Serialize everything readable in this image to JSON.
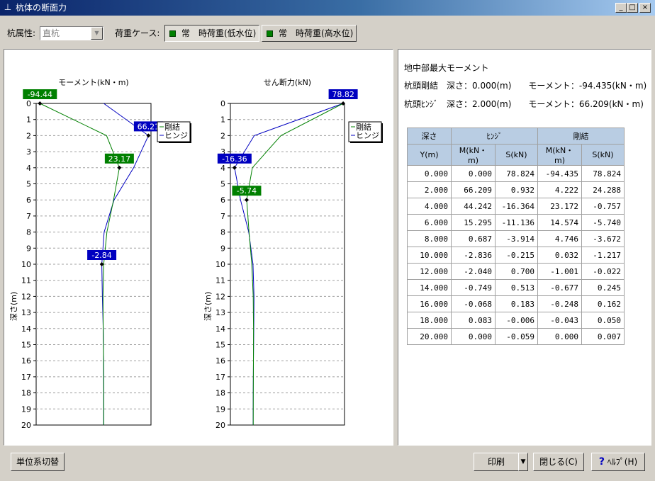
{
  "window": {
    "title": "杭体の断面力",
    "app_icon": "pile-icon",
    "min": "_",
    "max": "□",
    "close": "×"
  },
  "toolbar": {
    "pile_attr_label": "杭属性:",
    "pile_attr_value": "直杭",
    "load_case_label": "荷重ケース:",
    "case_low": "常　時荷重(低水位)",
    "case_high": "常　時荷重(高水位)"
  },
  "info": {
    "title": "地中部最大モーメント",
    "line1": "杭頭剛結　深さ：0.000(m)　　モーメント：-94.435(kN・m)",
    "line2": "杭頭ﾋﾝｼﾞ　深さ：2.000(m)　　モーメント：66.209(kN・m)"
  },
  "table": {
    "h_depth": "深さ",
    "h_hinge": "ﾋﾝｼﾞ",
    "h_rigid": "剛結",
    "sub_y": "Y(m)",
    "sub_m1": "M(kN・m)",
    "sub_s1": "S(kN)",
    "sub_m2": "M(kN・m)",
    "sub_s2": "S(kN)",
    "rows": [
      [
        "0.000",
        "0.000",
        "78.824",
        "-94.435",
        "78.824"
      ],
      [
        "2.000",
        "66.209",
        "0.932",
        "4.222",
        "24.288"
      ],
      [
        "4.000",
        "44.242",
        "-16.364",
        "23.172",
        "-0.757"
      ],
      [
        "6.000",
        "15.295",
        "-11.136",
        "14.574",
        "-5.740"
      ],
      [
        "8.000",
        "0.687",
        "-3.914",
        "4.746",
        "-3.672"
      ],
      [
        "10.000",
        "-2.836",
        "-0.215",
        "0.032",
        "-1.217"
      ],
      [
        "12.000",
        "-2.040",
        "0.700",
        "-1.001",
        "-0.022"
      ],
      [
        "14.000",
        "-0.749",
        "0.513",
        "-0.677",
        "0.245"
      ],
      [
        "16.000",
        "-0.068",
        "0.183",
        "-0.248",
        "0.162"
      ],
      [
        "18.000",
        "0.083",
        "-0.006",
        "-0.043",
        "0.050"
      ],
      [
        "20.000",
        "0.000",
        "-0.059",
        "0.000",
        "0.007"
      ]
    ]
  },
  "buttons": {
    "units": "単位系切替",
    "print": "印刷",
    "print_drop": "▼",
    "close": "閉じる(C)",
    "help": "ﾍﾙﾌﾟ(H)",
    "help_glyph": "?"
  },
  "colors": {
    "hinge": "#0000c0",
    "rigid": "#008000",
    "title_start": "#0a246a"
  },
  "chart_data": [
    {
      "type": "line",
      "title": "モーメント(kN・m)",
      "ylabel": "深さ(m)",
      "ylim": [
        0,
        20
      ],
      "y_ticks": [
        "0",
        "1",
        "2",
        "3",
        "4",
        "5",
        "6",
        "7",
        "8",
        "9",
        "10",
        "11",
        "12",
        "13",
        "14",
        "15",
        "16",
        "17",
        "18",
        "19",
        "20"
      ],
      "xlim": [
        -100,
        70
      ],
      "legend": [
        "剛結",
        "ヒンジ"
      ],
      "series": [
        {
          "name": "ヒンジ",
          "color": "#0000c0",
          "x": [
            0.0,
            66.209,
            44.242,
            15.295,
            0.687,
            -2.836,
            -2.04,
            -0.749,
            -0.068,
            0.083,
            0.0
          ],
          "y": [
            0,
            2,
            4,
            6,
            8,
            10,
            12,
            14,
            16,
            18,
            20
          ]
        },
        {
          "name": "剛結",
          "color": "#008000",
          "x": [
            -94.435,
            4.222,
            23.172,
            14.574,
            4.746,
            0.032,
            -1.001,
            -0.677,
            -0.248,
            -0.043,
            0.0
          ],
          "y": [
            0,
            2,
            4,
            6,
            8,
            10,
            12,
            14,
            16,
            18,
            20
          ]
        }
      ],
      "annotations": [
        {
          "text": "-94.44",
          "x": -94.435,
          "y": 0,
          "series": "剛結"
        },
        {
          "text": "66.21",
          "x": 66.209,
          "y": 2,
          "series": "ヒンジ"
        },
        {
          "text": "23.17",
          "x": 23.172,
          "y": 4,
          "series": "剛結"
        },
        {
          "text": "-2.84",
          "x": -2.836,
          "y": 10,
          "series": "ヒンジ"
        }
      ]
    },
    {
      "type": "line",
      "title": "せん断力(kN)",
      "ylabel": "深さ(m)",
      "ylim": [
        0,
        20
      ],
      "y_ticks": [
        "0",
        "1",
        "2",
        "3",
        "4",
        "5",
        "6",
        "7",
        "8",
        "9",
        "10",
        "11",
        "12",
        "13",
        "14",
        "15",
        "16",
        "17",
        "18",
        "19",
        "20"
      ],
      "xlim": [
        -20,
        80
      ],
      "legend": [
        "剛結",
        "ヒンジ"
      ],
      "series": [
        {
          "name": "ヒンジ",
          "color": "#0000c0",
          "x": [
            78.824,
            0.932,
            -16.364,
            -11.136,
            -3.914,
            -0.215,
            0.7,
            0.513,
            0.183,
            -0.006,
            -0.059
          ],
          "y": [
            0,
            2,
            4,
            6,
            8,
            10,
            12,
            14,
            16,
            18,
            20
          ]
        },
        {
          "name": "剛結",
          "color": "#008000",
          "x": [
            78.824,
            24.288,
            -0.757,
            -5.74,
            -3.672,
            -1.217,
            -0.022,
            0.245,
            0.162,
            0.05,
            0.007
          ],
          "y": [
            0,
            2,
            4,
            6,
            8,
            10,
            12,
            14,
            16,
            18,
            20
          ]
        }
      ],
      "annotations": [
        {
          "text": "78.82",
          "x": 78.824,
          "y": 0,
          "series": "ヒンジ"
        },
        {
          "text": "-16.36",
          "x": -16.364,
          "y": 4,
          "series": "ヒンジ"
        },
        {
          "text": "-5.74",
          "x": -5.74,
          "y": 6,
          "series": "剛結"
        }
      ]
    }
  ]
}
